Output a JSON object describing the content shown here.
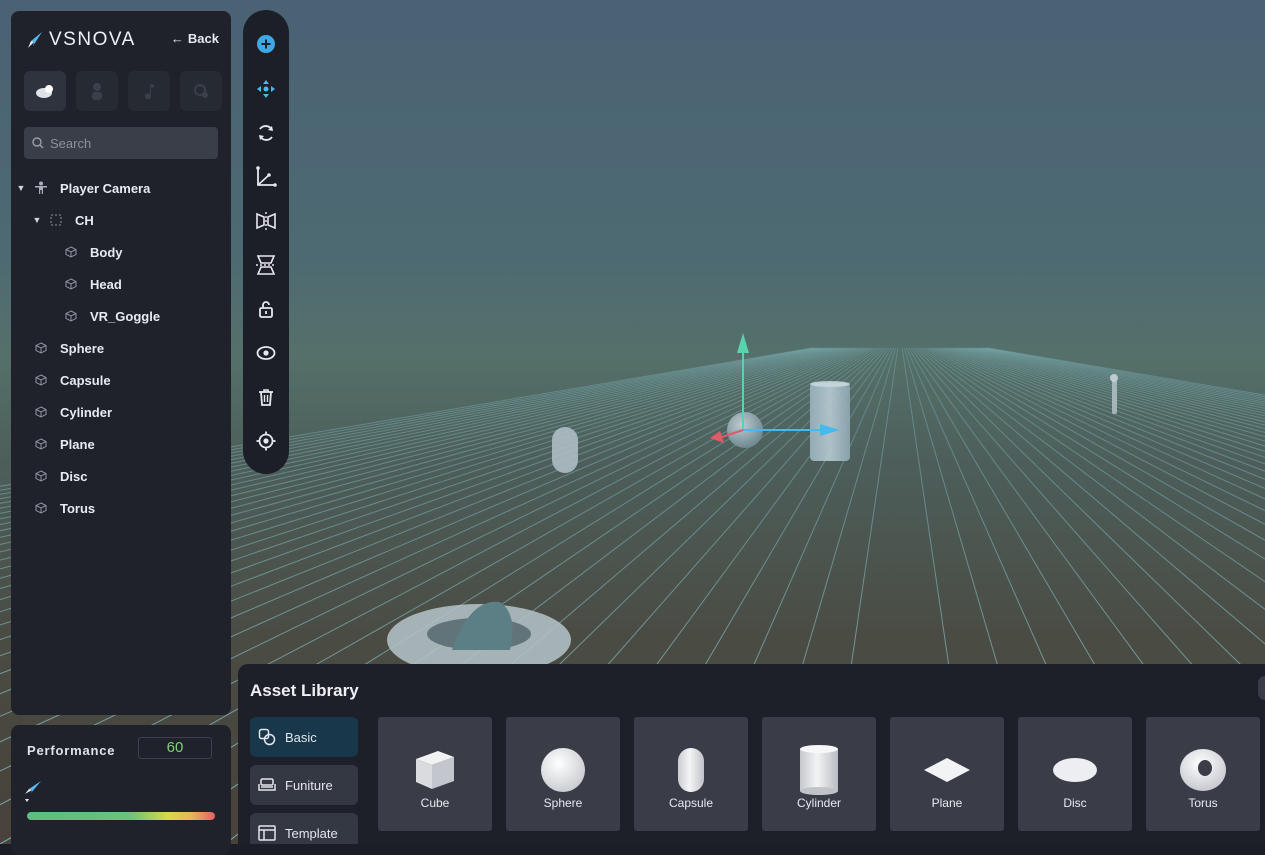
{
  "app": {
    "brand": "VSNOVA",
    "back_label": "Back"
  },
  "hierarchy": {
    "category_tabs": [
      {
        "icon": "cloud-icon",
        "active": true
      },
      {
        "icon": "person-icon",
        "active": false
      },
      {
        "icon": "music-note-icon",
        "active": false
      },
      {
        "icon": "settings-gear-icon",
        "active": false
      }
    ],
    "search_placeholder": "Search",
    "items": [
      {
        "label": "Player Camera",
        "depth": 0,
        "expanded": true,
        "icon": "person-figure-icon"
      },
      {
        "label": "CH",
        "depth": 1,
        "expanded": true,
        "icon": "dashed-box-icon"
      },
      {
        "label": "Body",
        "depth": 2,
        "icon": "cube-icon"
      },
      {
        "label": "Head",
        "depth": 2,
        "icon": "cube-icon"
      },
      {
        "label": "VR_Goggle",
        "depth": 2,
        "icon": "cube-icon"
      },
      {
        "label": "Sphere",
        "depth": 0,
        "icon": "cube-icon"
      },
      {
        "label": "Capsule",
        "depth": 0,
        "icon": "cube-icon"
      },
      {
        "label": "Cylinder",
        "depth": 0,
        "icon": "cube-icon"
      },
      {
        "label": "Plane",
        "depth": 0,
        "icon": "cube-icon"
      },
      {
        "label": "Disc",
        "depth": 0,
        "icon": "cube-icon"
      },
      {
        "label": "Torus",
        "depth": 0,
        "icon": "cube-icon"
      }
    ]
  },
  "performance": {
    "label": "Performance",
    "fps": "60"
  },
  "toolbar": {
    "tools": [
      {
        "name": "add-icon"
      },
      {
        "name": "move-icon"
      },
      {
        "name": "rotate-icon"
      },
      {
        "name": "axis-icon"
      },
      {
        "name": "mirror-horizontal-icon"
      },
      {
        "name": "mirror-vertical-icon"
      },
      {
        "name": "unlock-icon"
      },
      {
        "name": "visibility-icon"
      },
      {
        "name": "delete-icon"
      },
      {
        "name": "focus-target-icon"
      }
    ]
  },
  "asset_library": {
    "title": "Asset Library",
    "categories": [
      {
        "label": "Basic",
        "icon": "shapes-icon",
        "active": true
      },
      {
        "label": "Funiture",
        "icon": "sofa-icon",
        "active": false
      },
      {
        "label": "Template",
        "icon": "template-icon",
        "active": false
      }
    ],
    "assets": [
      {
        "label": "Cube"
      },
      {
        "label": "Sphere"
      },
      {
        "label": "Capsule"
      },
      {
        "label": "Cylinder"
      },
      {
        "label": "Plane"
      },
      {
        "label": "Disc"
      },
      {
        "label": "Torus"
      }
    ]
  },
  "colors": {
    "accent": "#3fa9e6",
    "panel": "#1f222b",
    "gizmo_x": "#e05a67",
    "gizmo_y": "#59d2b0",
    "gizmo_z": "#48b9ec"
  }
}
